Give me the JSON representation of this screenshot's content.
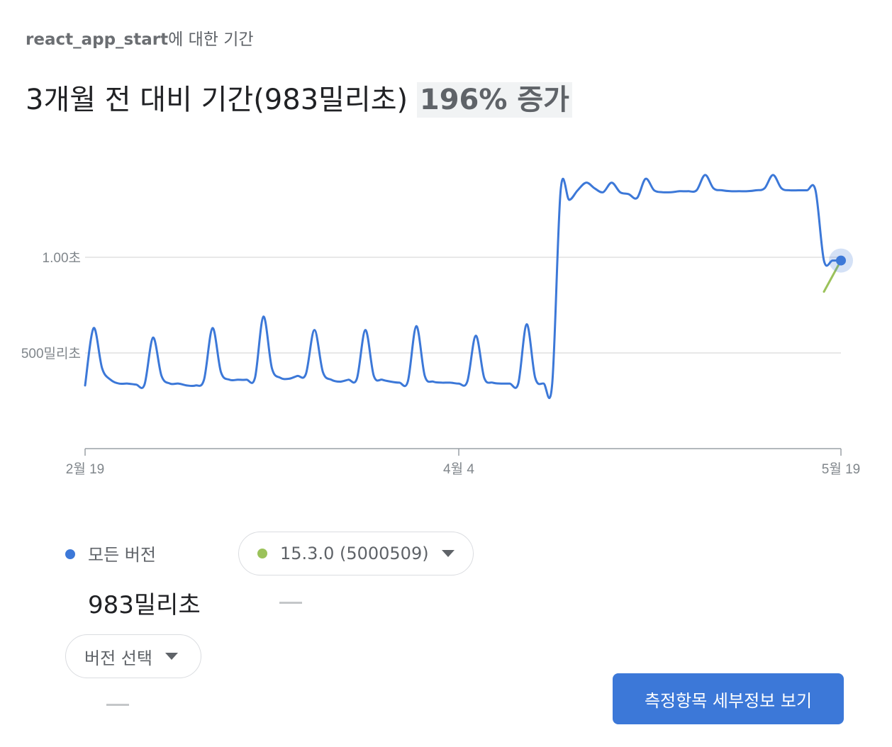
{
  "header": {
    "trace_name": "react_app_start",
    "trace_suffix": "에 대한 기간",
    "headline_main": "3개월 전 대비 기간(983밀리초)",
    "headline_change": "196% 증가"
  },
  "legend": {
    "all_versions_label": "모든 버전",
    "all_versions_value": "983밀리초",
    "version_dropdown_label": "15.3.0 (5000509)",
    "version_dropdown_value": "—",
    "select_version_label": "버전 선택",
    "select_version_value": "—"
  },
  "actions": {
    "details_button": "측정항목 세부정보 보기"
  },
  "colors": {
    "all_versions": "#3c78d8",
    "version": "#9bc25a",
    "grid": "#e0e0e0",
    "axis": "#9aa0a6"
  },
  "chart_data": {
    "type": "line",
    "xlabel": "",
    "ylabel": "",
    "x_tick_labels": [
      "2월 19",
      "4월 4",
      "5월 19"
    ],
    "y_tick_labels": [
      "500밀리초",
      "1.00초"
    ],
    "y_ticks": [
      500,
      1000
    ],
    "ylim": [
      0,
      1500
    ],
    "grid": true,
    "x_range_days": [
      0,
      89
    ],
    "series": [
      {
        "color": "#3c78d8",
        "x": [
          0,
          1,
          2,
          3,
          4,
          5,
          6,
          7,
          8,
          9,
          10,
          11,
          12,
          13,
          14,
          15,
          16,
          17,
          18,
          19,
          20,
          21,
          22,
          23,
          24,
          25,
          26,
          27,
          28,
          29,
          30,
          31,
          32,
          33,
          34,
          35,
          36,
          37,
          38,
          39,
          40,
          41,
          42,
          43,
          44,
          45,
          46,
          47,
          48,
          49,
          50,
          51,
          52,
          53,
          54,
          55,
          56,
          57,
          58,
          59,
          60,
          61,
          62,
          63,
          64,
          65,
          66,
          67,
          68,
          69,
          70,
          71,
          72,
          73,
          74,
          75,
          76,
          77,
          78,
          79,
          80,
          81,
          82,
          83,
          84,
          85,
          86,
          87,
          88,
          89
        ],
        "values": [
          330,
          630,
          420,
          360,
          340,
          340,
          335,
          335,
          580,
          380,
          340,
          340,
          330,
          330,
          360,
          630,
          400,
          360,
          360,
          360,
          370,
          690,
          420,
          370,
          365,
          380,
          390,
          620,
          400,
          360,
          350,
          360,
          365,
          620,
          380,
          360,
          350,
          345,
          350,
          640,
          380,
          350,
          345,
          345,
          340,
          350,
          590,
          370,
          345,
          340,
          340,
          340,
          650,
          370,
          340,
          340,
          1350,
          1300,
          1350,
          1390,
          1360,
          1340,
          1390,
          1340,
          1330,
          1310,
          1410,
          1350,
          1340,
          1340,
          1345,
          1345,
          1350,
          1430,
          1360,
          1350,
          1345,
          1345,
          1345,
          1350,
          1360,
          1430,
          1360,
          1350,
          1350,
          1350,
          1350,
          983,
          983,
          983
        ]
      },
      {
        "color": "#9bc25a",
        "x": [
          87,
          89
        ],
        "values": [
          820,
          983
        ]
      }
    ]
  }
}
